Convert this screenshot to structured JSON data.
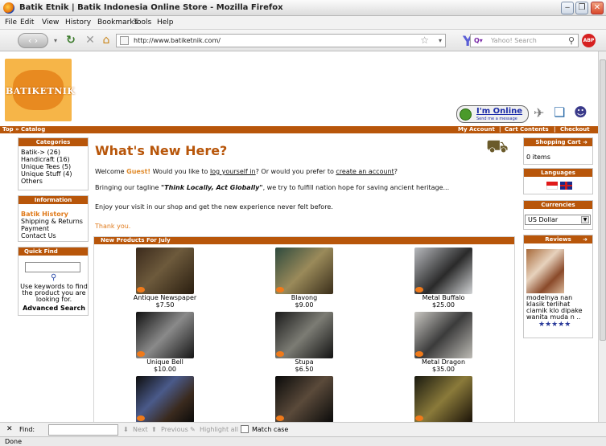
{
  "window": {
    "title": "Batik Etnik | Batik Indonesia Online Store - Mozilla Firefox"
  },
  "menu": [
    "File",
    "Edit",
    "View",
    "History",
    "Bookmarks",
    "Tools",
    "Help"
  ],
  "browser": {
    "url": "http://www.batiketnik.com/",
    "search_placeholder": "Yahoo! Search",
    "abp_label": "ABP",
    "status": "Done"
  },
  "findbar": {
    "label": "Find:",
    "next": "Next",
    "previous": "Previous",
    "highlight": "Highlight all",
    "match_case": "Match case"
  },
  "site": {
    "logo_text": "BATIKETNIK",
    "online": {
      "title": "I'm Online",
      "subtitle": "Send me a message"
    },
    "breadcrumb": "Top » Catalog",
    "top_links": [
      "My Account",
      "Cart Contents",
      "Checkout"
    ],
    "categories": {
      "title": "Categories",
      "items": [
        "Batik-> (26)",
        "Handicraft (16)",
        "Unique Tees (5)",
        "Unique Stuff (4)",
        "Others"
      ]
    },
    "information": {
      "title": "Information",
      "items": [
        "Batik History",
        "Shipping & Returns",
        "Payment",
        "Contact Us"
      ]
    },
    "quickfind": {
      "title": "Quick Find",
      "hint": "Use keywords to find the product you are looking for.",
      "advanced": "Advanced Search"
    },
    "main": {
      "title": "What's New Here?",
      "welcome_prefix": "Welcome ",
      "guest": "Guest!",
      "welcome_mid": " Would you like to ",
      "login_link": "log yourself in",
      "welcome_mid2": "? Or would you prefer to ",
      "account_link": "create an account",
      "welcome_end": "?",
      "tagline_prefix": "Bringing our tagline ",
      "tagline": "\"Think Locally, Act Globally\"",
      "tagline_suffix": ", we try to fulfill nation hope for saving ancient heritage...",
      "enjoy": "Enjoy your visit in our shop and get the new experience never felt before.",
      "thanks": "Thank you."
    },
    "products_header": "New Products For July",
    "products": [
      {
        "name": "Antique Newspaper",
        "price": "$7.50"
      },
      {
        "name": "Blavong",
        "price": "$9.00"
      },
      {
        "name": "Metal Buffalo",
        "price": "$25.00"
      },
      {
        "name": "Unique Bell",
        "price": "$10.00"
      },
      {
        "name": "Stupa",
        "price": "$6.50"
      },
      {
        "name": "Metal Dragon",
        "price": "$35.00"
      },
      {
        "name": "",
        "price": ""
      },
      {
        "name": "",
        "price": ""
      },
      {
        "name": "",
        "price": ""
      }
    ],
    "cart": {
      "title": "Shopping Cart",
      "items": "0 items"
    },
    "languages": {
      "title": "Languages"
    },
    "currencies": {
      "title": "Currencies",
      "selected": "US Dollar"
    },
    "reviews": {
      "title": "Reviews",
      "text": "modelnya nan klasik terlihat ciamik klo dipake wanita muda n ..",
      "stars": "★★★★★"
    }
  }
}
